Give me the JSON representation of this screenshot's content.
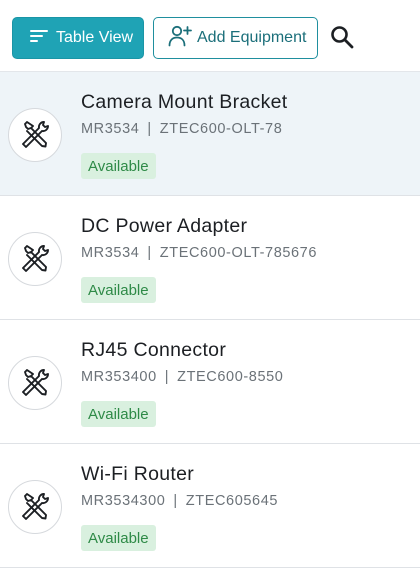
{
  "toolbar": {
    "table_view_label": "Table View",
    "add_equipment_label": "Add Equipment",
    "icons": {
      "table_view": "sort-lines-icon",
      "add_equipment": "add-user-icon",
      "search": "search-icon"
    }
  },
  "colors": {
    "primary": "#1fa3b5",
    "outline": "#1f8f9e",
    "selected_row": "#eef4f8",
    "badge_bg": "#d9f0df",
    "badge_text": "#2e8a47"
  },
  "equipment": [
    {
      "name": "Camera Mount Bracket",
      "code": "MR3534",
      "serial": "ZTEC600-OLT-78",
      "status": "Available",
      "selected": true,
      "icon": "tools-icon"
    },
    {
      "name": "DC Power Adapter",
      "code": "MR3534",
      "serial": "ZTEC600-OLT-785676",
      "status": "Available",
      "selected": false,
      "icon": "tools-icon"
    },
    {
      "name": "RJ45 Connector",
      "code": "MR353400",
      "serial": "ZTEC600-8550",
      "status": "Available",
      "selected": false,
      "icon": "tools-icon"
    },
    {
      "name": "Wi-Fi Router",
      "code": "MR3534300",
      "serial": "ZTEC605645",
      "status": "Available",
      "selected": false,
      "icon": "tools-icon"
    }
  ]
}
